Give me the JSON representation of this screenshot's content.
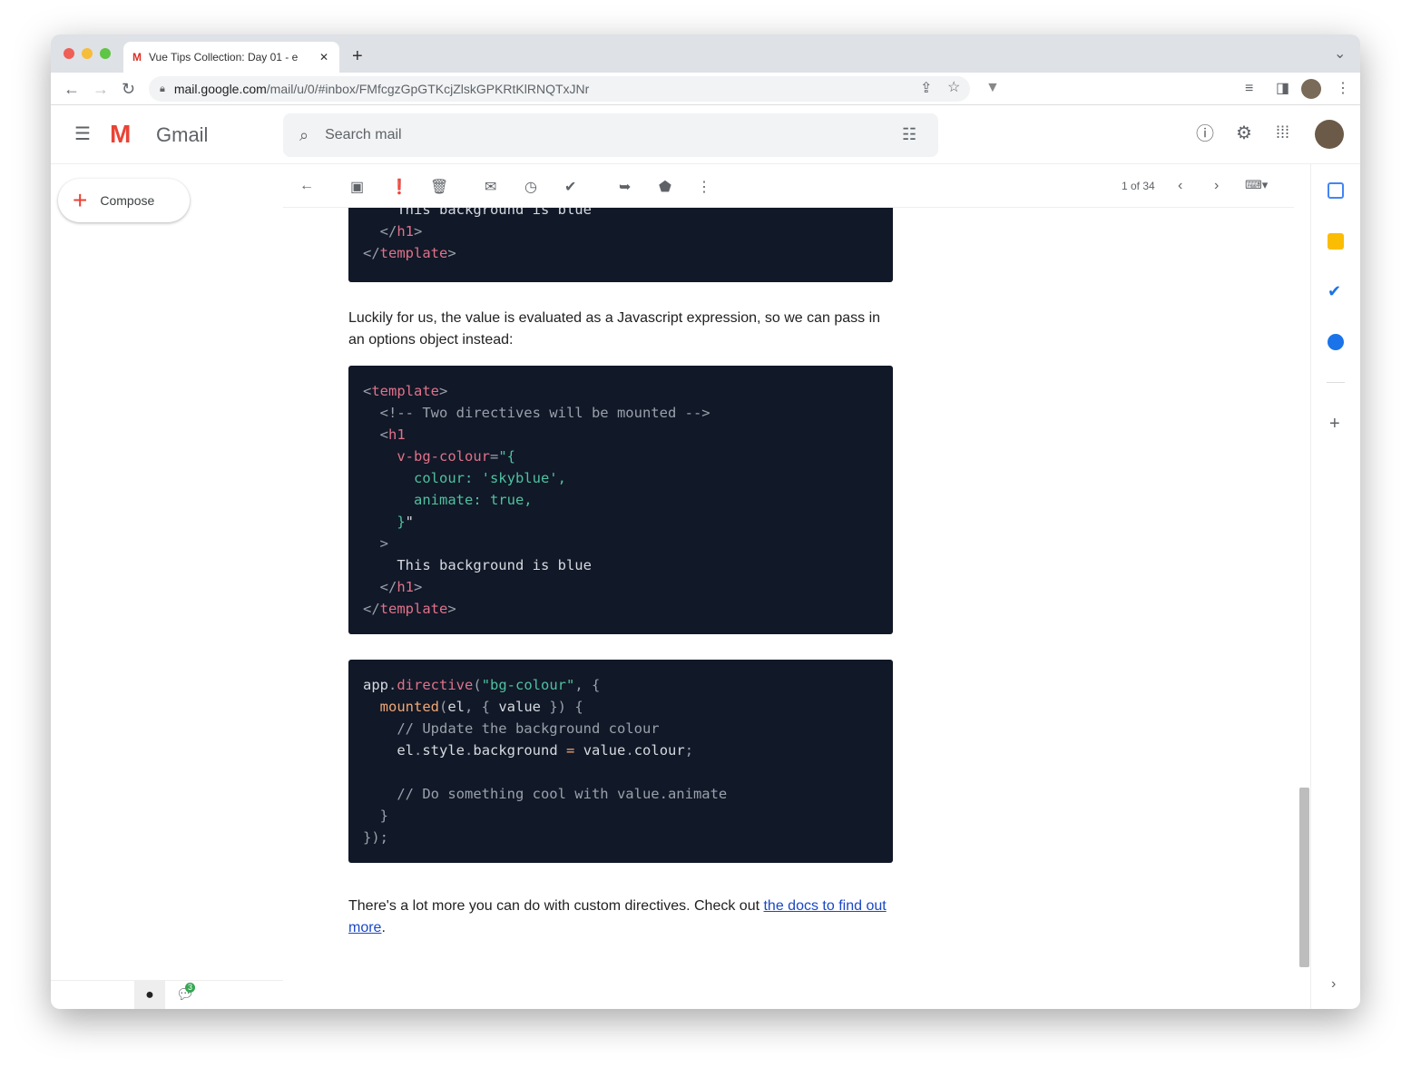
{
  "browser": {
    "tab_title": "Vue Tips Collection: Day 01 - e",
    "url_host": "mail.google.com",
    "url_path": "/mail/u/0/#inbox/FMfcgzGpGTKcjZlskGPKRtKlRNQTxJNr"
  },
  "gmail": {
    "logo_text": "Gmail",
    "search_placeholder": "Search mail",
    "compose": "Compose",
    "pagination": "1 of 34",
    "chat_badge": "3"
  },
  "email": {
    "code0": [
      [
        [
          "    ",
          "w"
        ],
        [
          "This background is blue",
          "w"
        ]
      ],
      [
        [
          "  </",
          "c"
        ],
        [
          "h1",
          "k"
        ],
        [
          ">",
          "c"
        ]
      ],
      [
        [
          "</",
          "c"
        ],
        [
          "template",
          "k"
        ],
        [
          ">",
          "c"
        ]
      ]
    ],
    "para1": "Luckily for us, the value is evaluated as a Javascript expression, so we can pass in an options object instead:",
    "code1": [
      [
        [
          "<",
          "c"
        ],
        [
          "template",
          "k"
        ],
        [
          ">",
          "c"
        ]
      ],
      [
        [
          "  <!-- Two directives will be mounted -->",
          "c"
        ]
      ],
      [
        [
          "  <",
          "c"
        ],
        [
          "h1",
          "k"
        ]
      ],
      [
        [
          "    v-bg-colour",
          "k"
        ],
        [
          "=",
          "c"
        ],
        [
          "\"{",
          "s"
        ]
      ],
      [
        [
          "      colour: 'skyblue',",
          "s"
        ]
      ],
      [
        [
          "      animate: true,",
          "s"
        ]
      ],
      [
        [
          "    }",
          "s"
        ],
        [
          "\"",
          "w"
        ]
      ],
      [
        [
          "  >",
          "c"
        ]
      ],
      [
        [
          "    This background is blue",
          "w"
        ]
      ],
      [
        [
          "  </",
          "c"
        ],
        [
          "h1",
          "k"
        ],
        [
          ">",
          "c"
        ]
      ],
      [
        [
          "</",
          "c"
        ],
        [
          "template",
          "k"
        ],
        [
          ">",
          "c"
        ]
      ]
    ],
    "code2": [
      [
        [
          "app",
          "w"
        ],
        [
          ".",
          "c"
        ],
        [
          "directive",
          "k"
        ],
        [
          "(",
          "c"
        ],
        [
          "\"bg-colour\"",
          "s"
        ],
        [
          ", {",
          "c"
        ]
      ],
      [
        [
          "  ",
          "w"
        ],
        [
          "mounted",
          "f"
        ],
        [
          "(",
          "c"
        ],
        [
          "el",
          "w"
        ],
        [
          ", { ",
          "c"
        ],
        [
          "value",
          "w"
        ],
        [
          " }) {",
          "c"
        ]
      ],
      [
        [
          "    // Update the background colour",
          "c"
        ]
      ],
      [
        [
          "    el",
          "w"
        ],
        [
          ".",
          "c"
        ],
        [
          "style",
          "w"
        ],
        [
          ".",
          "c"
        ],
        [
          "background",
          "w"
        ],
        [
          " = ",
          "f"
        ],
        [
          "value",
          "w"
        ],
        [
          ".",
          "c"
        ],
        [
          "colour",
          "w"
        ],
        [
          ";",
          "c"
        ]
      ],
      [
        [
          "",
          "w"
        ]
      ],
      [
        [
          "    // Do something cool with value.animate",
          "c"
        ]
      ],
      [
        [
          "  }",
          "c"
        ]
      ],
      [
        [
          "});",
          "c"
        ]
      ]
    ],
    "para2_text": "There's a lot more you can do with custom directives. Check out ",
    "para2_link": "the docs to find out more",
    "para2_end": "."
  }
}
